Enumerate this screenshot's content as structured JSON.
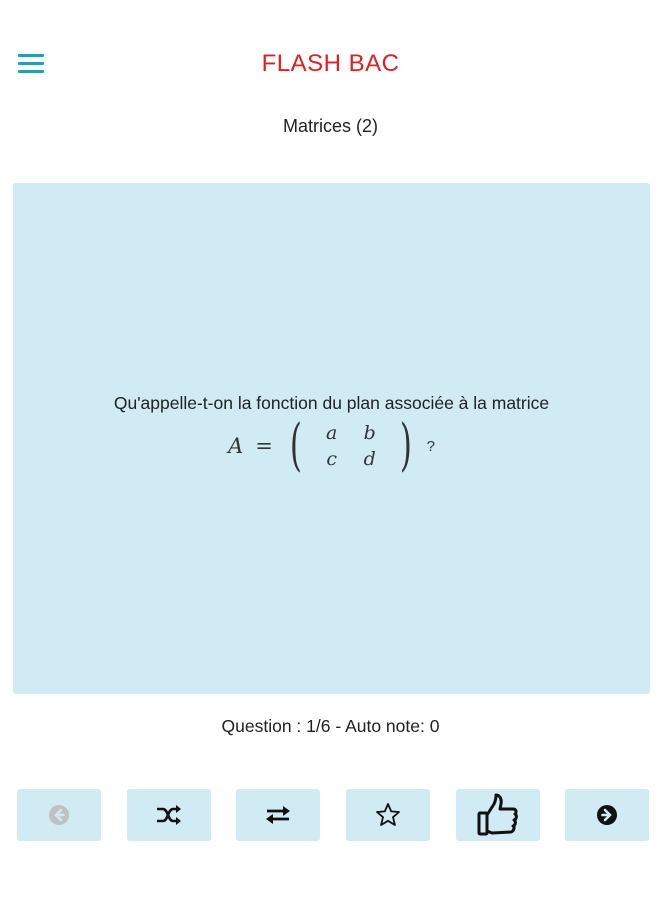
{
  "header": {
    "app_title": "FLASH BAC",
    "menu_icon": "hamburger-menu-icon"
  },
  "deck": {
    "title": "Matrices (2)"
  },
  "card": {
    "question": "Qu'appelle-t-on la fonction du plan associée à la matrice",
    "formula": {
      "lhs": "A",
      "eq": "=",
      "matrix": [
        "a",
        "b",
        "c",
        "d"
      ],
      "suffix": "?"
    }
  },
  "status": {
    "text": "Question : 1/6 - Auto note: 0"
  },
  "toolbar": {
    "buttons": [
      {
        "icon": "previous-arrow-icon",
        "enabled": false
      },
      {
        "icon": "shuffle-icon",
        "enabled": true
      },
      {
        "icon": "swap-icon",
        "enabled": true
      },
      {
        "icon": "star-icon",
        "enabled": true
      },
      {
        "icon": "thumbs-up-icon",
        "enabled": true
      },
      {
        "icon": "next-arrow-icon",
        "enabled": true
      }
    ]
  },
  "colors": {
    "accent": "#e02020",
    "menu": "#2a9ab8",
    "card_bg": "#d0ebf4",
    "disabled_icon": "#c0c0c0"
  }
}
